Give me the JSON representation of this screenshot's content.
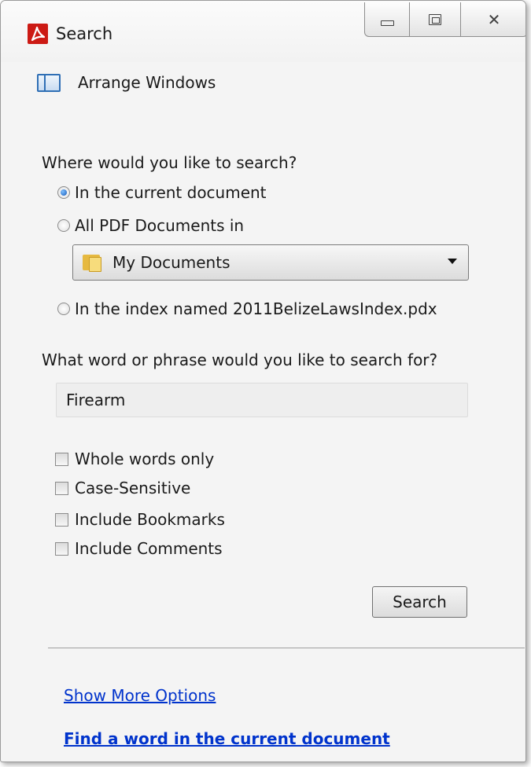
{
  "window": {
    "title": "Search",
    "app_icon": "acrobat-icon",
    "controls": [
      "minimize-icon",
      "maximize-icon",
      "close-icon"
    ]
  },
  "arrange": {
    "label": "Arrange Windows",
    "icon": "arrange-windows-icon"
  },
  "where": {
    "label": "Where would you like to search?",
    "options": [
      {
        "label": "In the current document",
        "checked": true
      },
      {
        "label": "All PDF Documents in",
        "checked": false
      },
      {
        "label": "In the index named 2011BelizeLawsIndex.pdx",
        "checked": false
      }
    ],
    "location": {
      "value": "My Documents",
      "icon": "folder-icon"
    }
  },
  "phrase": {
    "label": "What word or phrase would you like to search for?",
    "value": "Firearm"
  },
  "checkboxes": [
    {
      "label": "Whole words only",
      "checked": false
    },
    {
      "label": "Case-Sensitive",
      "checked": false
    },
    {
      "label": "Include Bookmarks",
      "checked": false
    },
    {
      "label": "Include Comments",
      "checked": false
    }
  ],
  "search_button": "Search",
  "links": {
    "more_options": "Show More Options",
    "find_word": "Find a word in the current document"
  },
  "colors": {
    "link": "#0033cc",
    "accent": "#cc1a14",
    "window_bg": "#f4f4f4"
  }
}
